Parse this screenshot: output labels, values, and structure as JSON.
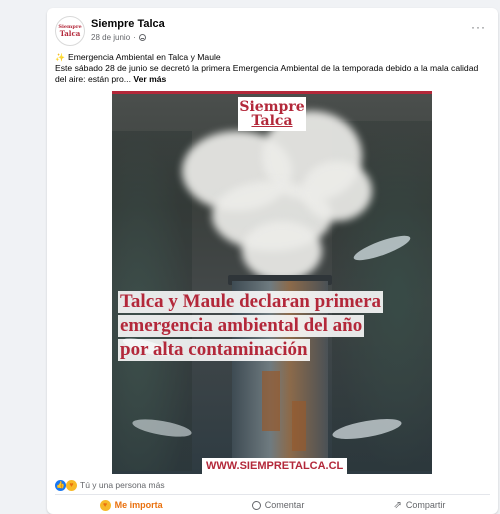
{
  "post": {
    "page_name": "Siempre Talca",
    "avatar_text": [
      "Siempre",
      "Talca"
    ],
    "date": "28 de junio",
    "dot": "·",
    "headline": "Emergencia Ambiental en Talca y Maule",
    "body": "Este sábado 28 de junio se decretó la primera Emergencia Ambiental de la temporada debido a la mala calidad del aire: están pro...",
    "see_more": "Ver más",
    "more_label": "···"
  },
  "image": {
    "brand_top": "Siempre",
    "brand_bottom": "Talca",
    "title_lines": [
      "Talca y Maule declaran primera",
      "emergencia ambiental del año",
      "por alta contaminación"
    ],
    "site": "WWW.SIEMPRETALCA.CL"
  },
  "reactions": {
    "summary": "Tú y una persona más"
  },
  "actions": {
    "care_label": "Me importa",
    "comment_label": "Comentar",
    "share_label": "Compartir"
  },
  "colors": {
    "brand": "#b3283a",
    "facebook_blue": "#1877f2",
    "care_orange": "#e9710f"
  }
}
